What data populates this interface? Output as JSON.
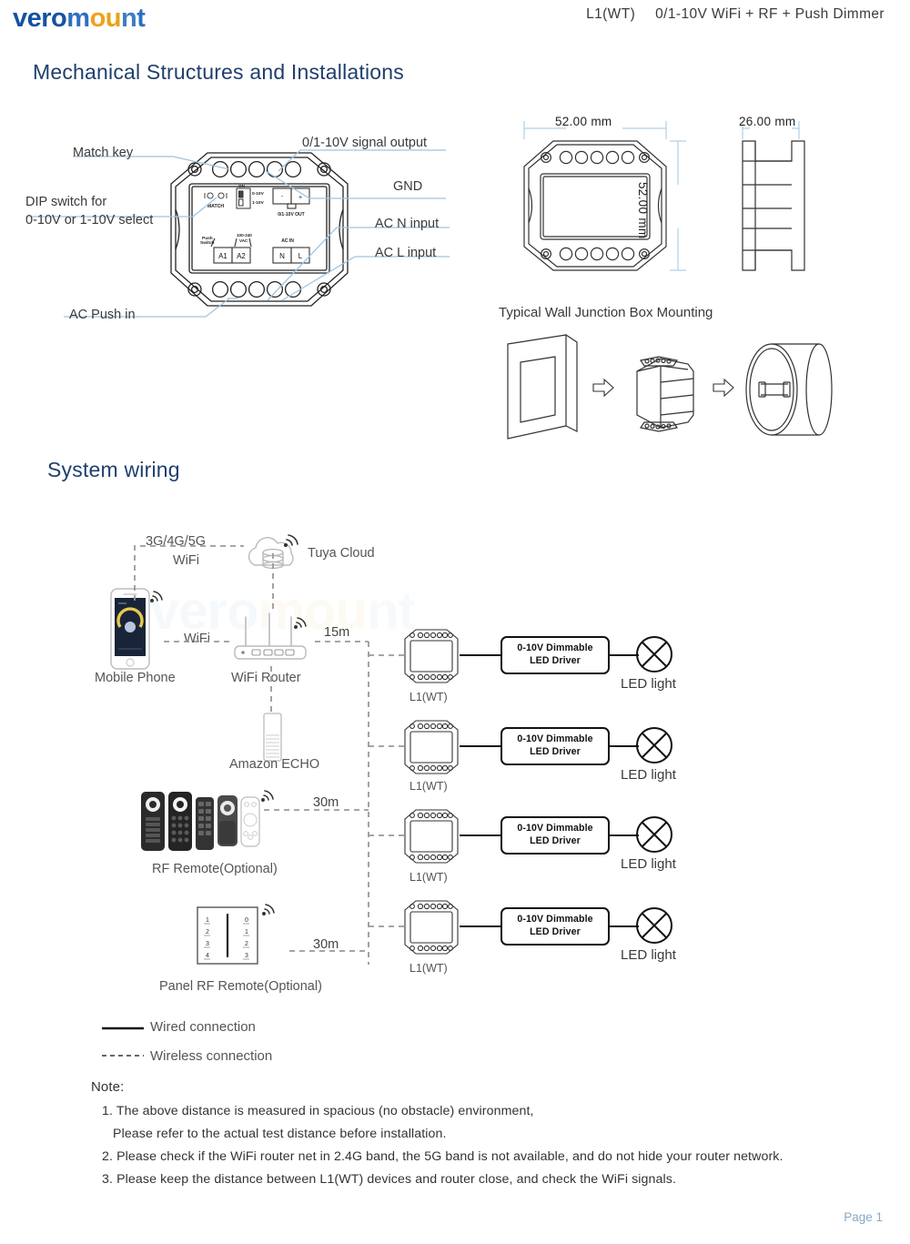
{
  "header": {
    "logo_vero": "vero",
    "logo_m": "m",
    "logo_o": "o",
    "logo_u": "u",
    "logo_n": "n",
    "logo_t": "t",
    "model": "L1(WT)",
    "title": "0/1-10V WiFi + RF + Push Dimmer",
    "colors": {
      "blue": "#1452a0",
      "blue2": "#2f6fc0",
      "orange": "#f0a11e",
      "gold": "#e8a317"
    }
  },
  "sections": {
    "mechanical": "Mechanical Structures and Installations",
    "system_wiring": "System wiring",
    "wall_mounting": "Typical Wall Junction Box Mounting"
  },
  "callouts": {
    "match_key": "Match key",
    "signal_output": "0/1-10V signal output",
    "gnd": "GND",
    "dip_switch_l1": "DIP switch for",
    "dip_switch_l2": "0-10V or 1-10V select",
    "ac_n_input": "AC N input",
    "ac_l_input": "AC L input",
    "ac_push_in": "AC Push in"
  },
  "board_labels": {
    "match": "MATCH",
    "dip_on": "ON",
    "dip_opt1": "0-10V",
    "dip_opt2": "1-10V",
    "out_minus": "-",
    "out_plus": "+",
    "out_name": "0/1-10V OUT",
    "push_switch_l1": "Push",
    "push_switch_l2": "Switch",
    "vac_l1": "100-240",
    "vac_l2": "VAC",
    "a1": "A1",
    "a2": "A2",
    "ac_in": "AC IN",
    "n": "N",
    "l": "L"
  },
  "dimensions": {
    "width": "52.00 mm",
    "height": "52.00 mm",
    "depth": "26.00 mm"
  },
  "wiring": {
    "cellular": "3G/4G/5G",
    "cellular_wifi": "WiFi",
    "tuya_cloud": "Tuya Cloud",
    "mobile_phone": "Mobile Phone",
    "wifi_link": "WiFi",
    "wifi_router": "WiFi Router",
    "amazon_echo": "Amazon ECHO",
    "rf_remote": "RF Remote(Optional)",
    "panel_rf_remote": "Panel RF Remote(Optional)",
    "panel_left_keys": [
      "1",
      "2",
      "3",
      "4"
    ],
    "panel_right_keys": [
      "0",
      "1",
      "2",
      "3"
    ],
    "distances": [
      "15m",
      "30m",
      "30m"
    ],
    "rows": [
      {
        "device": "L1(WT)",
        "driver_l1": "0-10V Dimmable",
        "driver_l2": "LED Driver",
        "light": "LED light"
      },
      {
        "device": "L1(WT)",
        "driver_l1": "0-10V Dimmable",
        "driver_l2": "LED Driver",
        "light": "LED light"
      },
      {
        "device": "L1(WT)",
        "driver_l1": "0-10V Dimmable",
        "driver_l2": "LED Driver",
        "light": "LED light"
      },
      {
        "device": "L1(WT)",
        "driver_l1": "0-10V Dimmable",
        "driver_l2": "LED Driver",
        "light": "LED light"
      }
    ]
  },
  "legend": {
    "wired": "Wired connection",
    "wireless": "Wireless connection"
  },
  "notes": {
    "heading": "Note:",
    "items": [
      "1. The above distance is measured in spacious (no obstacle) environment,",
      "Please refer to the actual test distance before installation.",
      "2. Please check if the WiFi router net in 2.4G band, the 5G band is not available, and do not hide your router network.",
      "3. Please keep the distance between L1(WT) devices and router close, and check the WiFi signals."
    ]
  },
  "watermark": "veromount",
  "footer": {
    "page": "Page 1"
  }
}
